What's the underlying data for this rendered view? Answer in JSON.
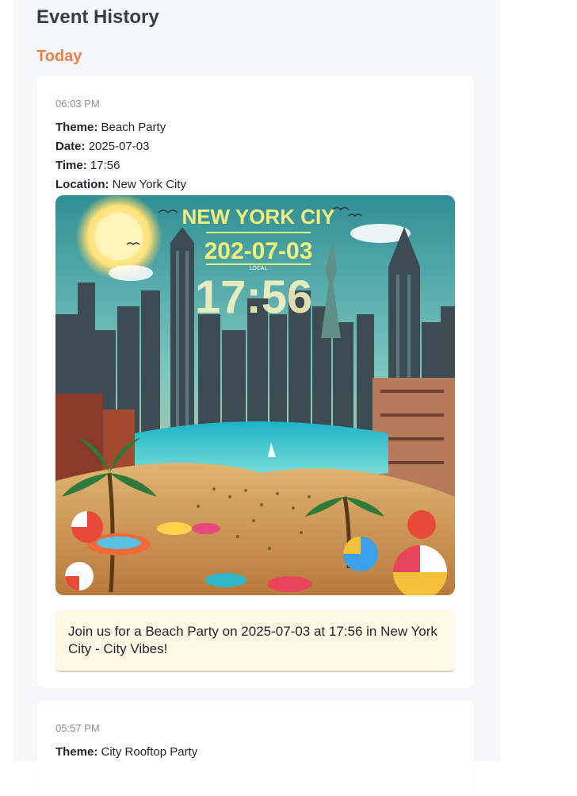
{
  "header": {
    "title": "Event History"
  },
  "section": {
    "label": "Today"
  },
  "events": [
    {
      "time": "06:03 PM",
      "theme_label": "Theme:",
      "theme": "Beach Party",
      "date_label": "Date:",
      "date": "2025-07-03",
      "time_label": "Time:",
      "event_time": "17:56",
      "location_label": "Location:",
      "location": "New York City",
      "poster": {
        "headline": "NEW YORK CIY",
        "date_text": "202-07-03",
        "time_text": "17:56",
        "small_text": "LOCAL"
      },
      "message": "Join us for a Beach Party on 2025-07-03 at 17:56 in New York City - City Vibes!"
    },
    {
      "time": "05:57 PM",
      "theme_label": "Theme:",
      "theme": "City Rooftop Party"
    }
  ],
  "colors": {
    "accent": "#f07f4a",
    "panel_bg": "#f6f7f9",
    "message_bg": "#fff8e5"
  }
}
